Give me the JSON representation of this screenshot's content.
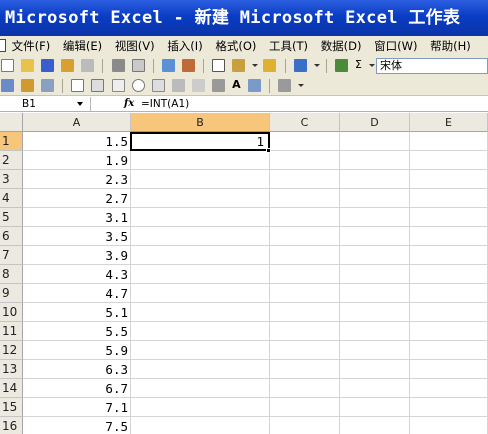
{
  "window": {
    "title": "Microsoft Excel - 新建 Microsoft Excel 工作表"
  },
  "menu": [
    {
      "label": "文件(F)"
    },
    {
      "label": "编辑(E)"
    },
    {
      "label": "视图(V)"
    },
    {
      "label": "插入(I)"
    },
    {
      "label": "格式(O)"
    },
    {
      "label": "工具(T)"
    },
    {
      "label": "数据(D)"
    },
    {
      "label": "窗口(W)"
    },
    {
      "label": "帮助(H)"
    }
  ],
  "toolbar": {
    "font_name": "宋体"
  },
  "formula_bar": {
    "name_box": "B1",
    "fx_label": "fx",
    "formula": "=INT(A1)"
  },
  "grid": {
    "columns": [
      "A",
      "B",
      "C",
      "D",
      "E"
    ],
    "active_column": "B",
    "active_row": 1,
    "rows": [
      {
        "num": "1",
        "a": "1.5"
      },
      {
        "num": "2",
        "a": "1.9"
      },
      {
        "num": "3",
        "a": "2.3"
      },
      {
        "num": "4",
        "a": "2.7"
      },
      {
        "num": "5",
        "a": "3.1"
      },
      {
        "num": "6",
        "a": "3.5"
      },
      {
        "num": "7",
        "a": "3.9"
      },
      {
        "num": "8",
        "a": "4.3"
      },
      {
        "num": "9",
        "a": "4.7"
      },
      {
        "num": "10",
        "a": "5.1"
      },
      {
        "num": "11",
        "a": "5.5"
      },
      {
        "num": "12",
        "a": "5.9"
      },
      {
        "num": "13",
        "a": "6.3"
      },
      {
        "num": "14",
        "a": "6.7"
      },
      {
        "num": "15",
        "a": "7.1"
      },
      {
        "num": "16",
        "a": "7.5"
      }
    ],
    "b1_value": "1"
  },
  "colors": {
    "title_bar": "#0a3dc4",
    "active_header": "#f7c67a",
    "chrome": "#ece9d8"
  }
}
